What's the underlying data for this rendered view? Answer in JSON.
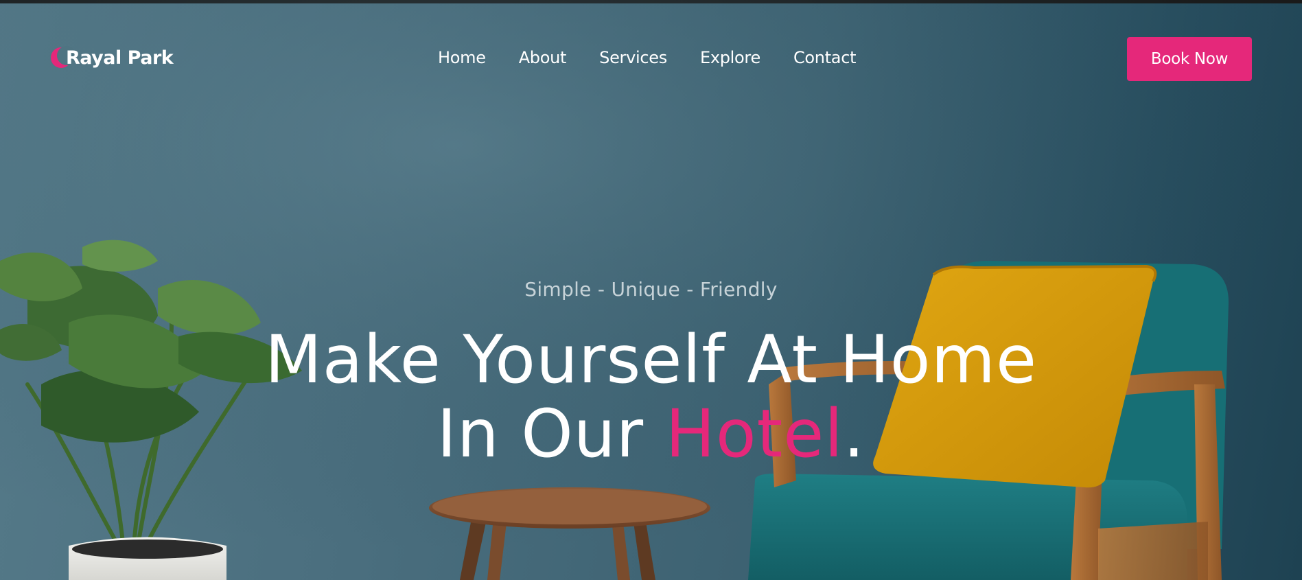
{
  "brand": {
    "name": "Rayal Park",
    "logo_icon": "crescent-moon-icon",
    "accent_color": "#e5287a"
  },
  "nav": {
    "links": [
      "Home",
      "About",
      "Services",
      "Explore",
      "Contact"
    ],
    "cta_label": "Book Now"
  },
  "hero": {
    "tagline": "Simple - Unique - Friendly",
    "headline_line1": "Make Yourself At Home",
    "headline_line2_prefix": "In Our ",
    "headline_highlight": "Hotel",
    "headline_suffix": ".",
    "background_image": "living room with plant, wooden side table and teal armchair with yellow cushion"
  }
}
